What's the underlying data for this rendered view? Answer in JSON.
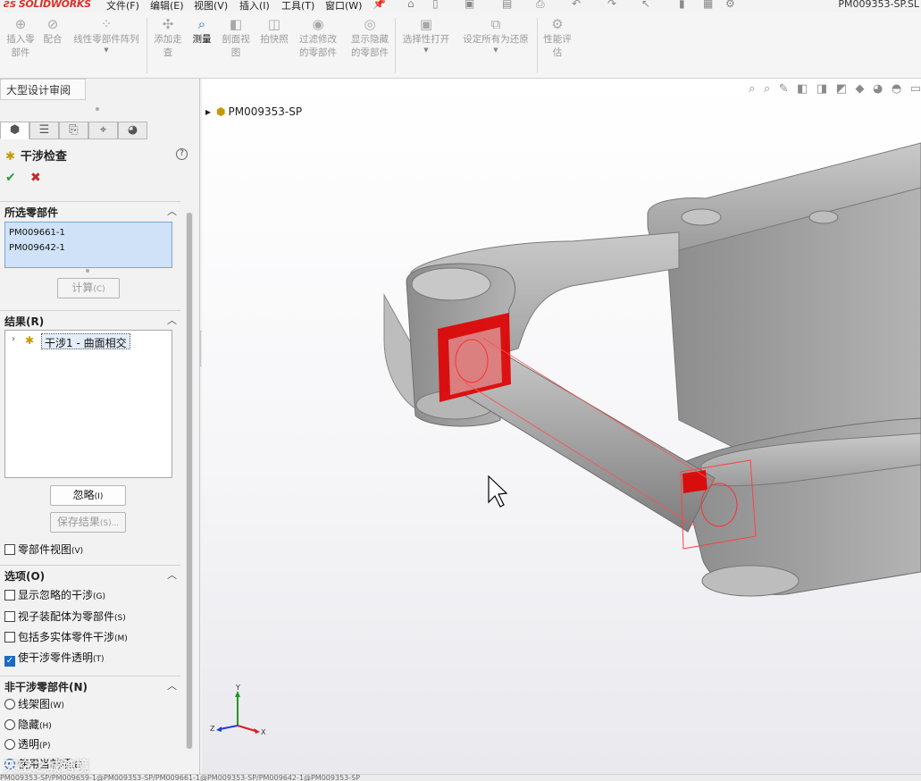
{
  "app": {
    "brand_prefix": "ƧS",
    "brand_name": "SOLIDWORKS",
    "document_title": "PM009353-SP.SL"
  },
  "menu": [
    "文件(F)",
    "编辑(E)",
    "视图(V)",
    "插入(I)",
    "工具(T)",
    "窗口(W)"
  ],
  "commands": [
    {
      "label": "插入零\n部件",
      "icon": "insert-component-icon",
      "enabled": false
    },
    {
      "label": "配合",
      "icon": "mate-icon",
      "enabled": false
    },
    {
      "label": "线性零部件阵列",
      "icon": "linear-pattern-icon",
      "enabled": false
    },
    {
      "label": "添加走\n查",
      "icon": "add-walkthrough-icon",
      "enabled": false
    },
    {
      "label": "测量",
      "icon": "measure-icon",
      "enabled": true
    },
    {
      "label": "剖面视\n图",
      "icon": "section-view-icon",
      "enabled": false
    },
    {
      "label": "拍快照",
      "icon": "snapshot-icon",
      "enabled": false
    },
    {
      "label": "过滤修改\n的零部件",
      "icon": "filter-modified-icon",
      "enabled": false
    },
    {
      "label": "显示隐藏\n的零部件",
      "icon": "show-hidden-icon",
      "enabled": false
    },
    {
      "label": "选择性打开",
      "icon": "selective-open-icon",
      "enabled": false
    },
    {
      "label": "设定所有为还原",
      "icon": "set-resolved-icon",
      "enabled": false
    },
    {
      "label": "性能评\n估",
      "icon": "performance-evaluation-icon",
      "enabled": false
    }
  ],
  "left_panel": {
    "tab_label": "大型设计审阅",
    "pm_title": "干涉检查",
    "help": "?",
    "ok": "✔",
    "cancel": "✖",
    "selected_section": {
      "title": "所选零部件",
      "items": [
        "PM009661-1",
        "PM009642-1"
      ],
      "calc_button": "计算",
      "calc_shortcut": "(C)"
    },
    "results_section": {
      "title": "结果(R)",
      "items": [
        "干涉1 - 曲面相交"
      ],
      "ignore_button": "忽略",
      "ignore_shortcut": "(I)",
      "save_button": "保存结果",
      "save_shortcut": "(S)..."
    },
    "component_view": {
      "label": "零部件视图",
      "shortcut": "(V)",
      "checked": false
    },
    "options_section": {
      "title": "选项(O)",
      "items": [
        {
          "label": "显示忽略的干涉",
          "shortcut": "(G)",
          "checked": false
        },
        {
          "label": "视子装配体为零部件",
          "shortcut": "(S)",
          "checked": false
        },
        {
          "label": "包括多实体零件干涉",
          "shortcut": "(M)",
          "checked": false
        },
        {
          "label": "使干涉零件透明",
          "shortcut": "(T)",
          "checked": true
        }
      ]
    },
    "noninterfering_section": {
      "title": "非干涉零部件(N)",
      "items": [
        {
          "label": "线架图",
          "shortcut": "(W)",
          "selected": false
        },
        {
          "label": "隐藏",
          "shortcut": "(H)",
          "selected": false
        },
        {
          "label": "透明",
          "shortcut": "(P)",
          "selected": false
        },
        {
          "label": "使用当前项",
          "shortcut": "(E)",
          "selected": true
        }
      ]
    },
    "watermark": "天空之城跨境"
  },
  "graphics": {
    "tree_root": "PM009353-SP",
    "triad": {
      "x": "X",
      "y": "Y",
      "z": "Z"
    },
    "colors": {
      "interference": "#e00000",
      "model": "#a9a9a9"
    }
  },
  "status_bar": "PM009353-SP/PM009659-1@PM009353-SP/PM009661-1@PM009353-SP/PM009642-1@PM009353-SP"
}
